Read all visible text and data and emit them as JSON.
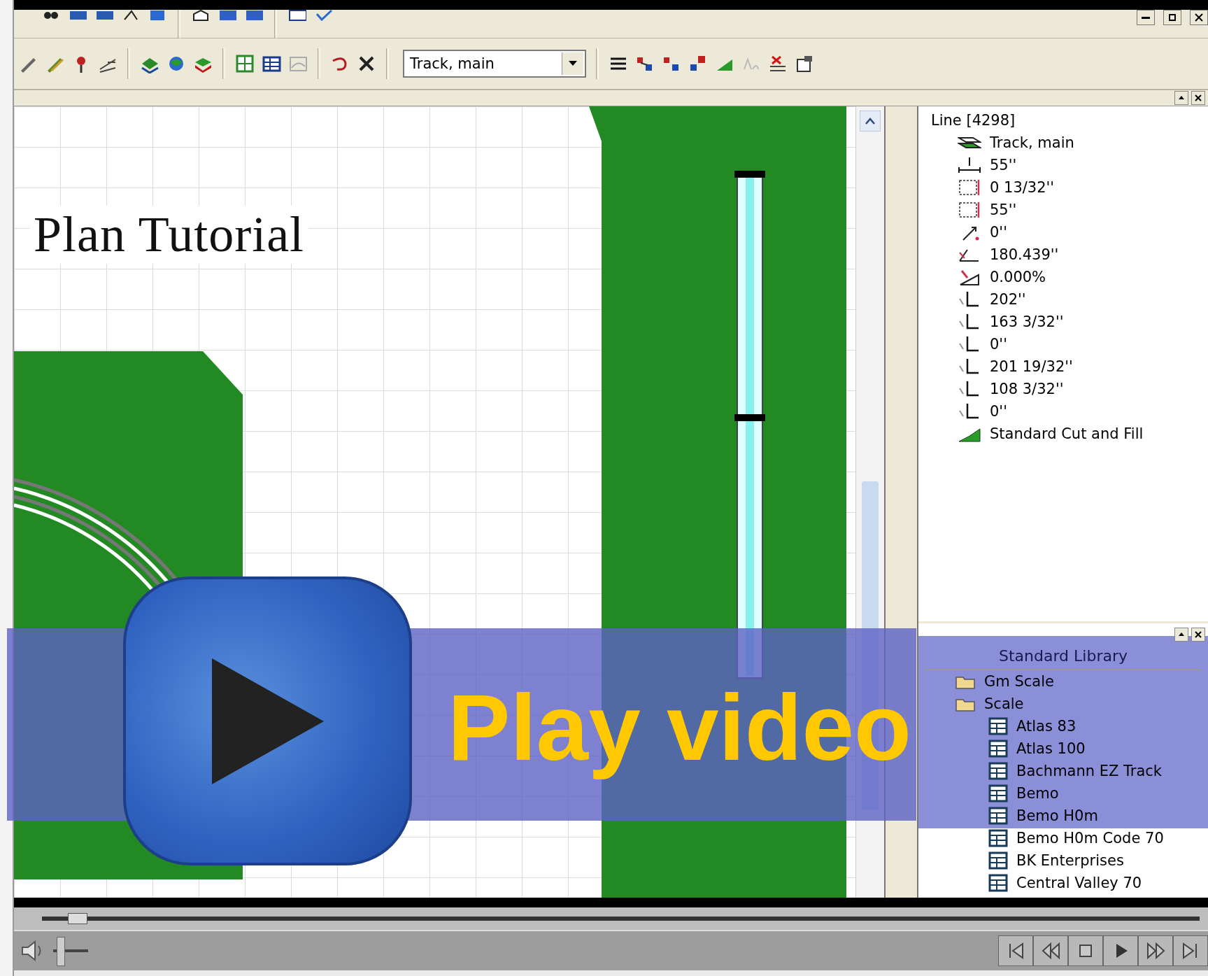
{
  "toolbar": {
    "layer_dropdown": {
      "value": "Track, main"
    }
  },
  "canvas": {
    "title": "Plan Tutorial"
  },
  "properties_panel": {
    "title": "Line [4298]",
    "rows": [
      {
        "kind": "track",
        "value": "Track, main"
      },
      {
        "kind": "length",
        "value": "55''"
      },
      {
        "kind": "dx",
        "value": "0 13/32''"
      },
      {
        "kind": "dy",
        "value": "55''"
      },
      {
        "kind": "dz",
        "value": "0''"
      },
      {
        "kind": "angle",
        "value": "180.439''"
      },
      {
        "kind": "grade",
        "value": "0.000%"
      },
      {
        "kind": "axis",
        "value": "202''"
      },
      {
        "kind": "axis",
        "value": "163 3/32''"
      },
      {
        "kind": "axis",
        "value": "0''"
      },
      {
        "kind": "axis",
        "value": "201 19/32''"
      },
      {
        "kind": "axis",
        "value": "108 3/32''"
      },
      {
        "kind": "axis",
        "value": "0''"
      },
      {
        "kind": "cutfill",
        "value": "Standard Cut and Fill"
      }
    ]
  },
  "library_panel": {
    "title": "Standard Library",
    "tree": [
      {
        "label": "Gm Scale"
      },
      {
        "label": "Scale",
        "children": [
          {
            "label": "Atlas  83"
          },
          {
            "label": "Atlas 100"
          },
          {
            "label": "Bachmann EZ Track"
          },
          {
            "label": "Bemo"
          },
          {
            "label": "Bemo H0m"
          },
          {
            "label": "Bemo H0m Code 70"
          },
          {
            "label": "BK Enterprises"
          },
          {
            "label": "Central Valley  70"
          }
        ]
      }
    ]
  },
  "overlay": {
    "label": "Play video"
  },
  "player": {
    "seek": {
      "level": 0.03
    },
    "volume": {
      "level": 0.1
    }
  }
}
